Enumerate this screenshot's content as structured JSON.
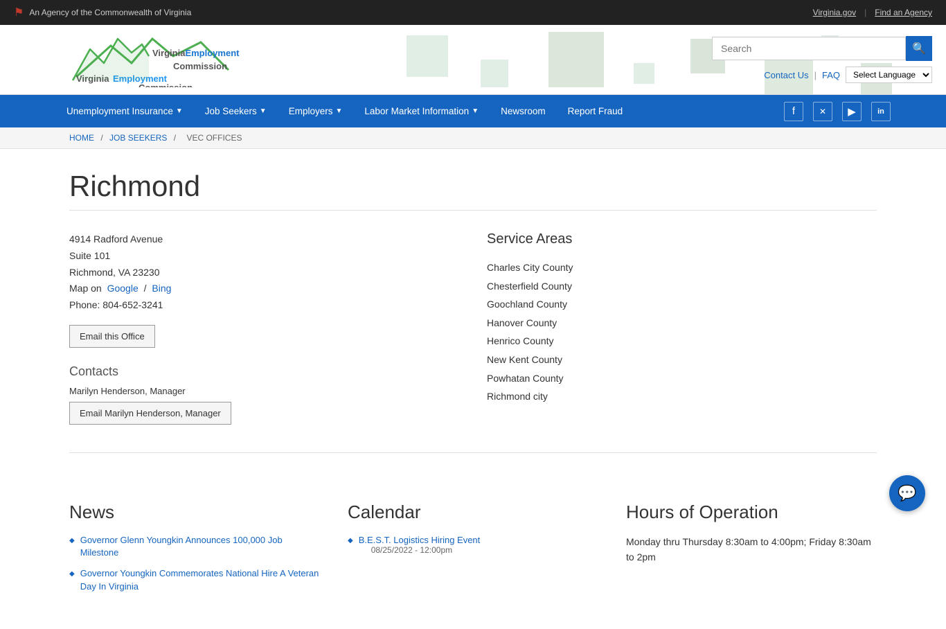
{
  "topbar": {
    "agency_text": "An Agency of the Commonwealth of Virginia",
    "virginia_link": "Virginia.gov",
    "find_agency_link": "Find an Agency"
  },
  "header": {
    "logo_line1": "Virginia",
    "logo_line2": "Employment",
    "logo_line3": "Commission",
    "search_placeholder": "Search",
    "contact_us": "Contact Us",
    "faq": "FAQ",
    "language_select": "Select Language"
  },
  "nav": {
    "items": [
      {
        "label": "Unemployment Insurance",
        "has_dropdown": true
      },
      {
        "label": "Job Seekers",
        "has_dropdown": true
      },
      {
        "label": "Employers",
        "has_dropdown": true
      },
      {
        "label": "Labor Market Information",
        "has_dropdown": true
      },
      {
        "label": "Newsroom",
        "has_dropdown": false
      },
      {
        "label": "Report Fraud",
        "has_dropdown": false
      }
    ],
    "social": [
      "f",
      "𝕏",
      "▶",
      "in"
    ]
  },
  "breadcrumb": {
    "items": [
      "HOME",
      "JOB SEEKERS",
      "VEC OFFICES"
    ]
  },
  "office": {
    "title": "Richmond",
    "address_line1": "4914 Radford Avenue",
    "address_line2": "Suite 101",
    "address_line3": "Richmond, VA 23230",
    "map_prefix": "Map on",
    "map_google": "Google",
    "map_separator": "/",
    "map_bing": "Bing",
    "phone": "Phone: 804-652-3241",
    "email_office_btn": "Email this Office",
    "contacts_title": "Contacts",
    "contact_name": "Marilyn Henderson, Manager",
    "contact_email_btn": "Email Marilyn Henderson, Manager"
  },
  "service_areas": {
    "title": "Service Areas",
    "areas": [
      "Charles City County",
      "Chesterfield County",
      "Goochland County",
      "Hanover County",
      "Henrico County",
      "New Kent County",
      "Powhatan County",
      "Richmond city"
    ]
  },
  "news": {
    "title": "News",
    "items": [
      {
        "text": "Governor Glenn Youngkin Announces 100,000 Job Milestone"
      },
      {
        "text": "Governor Youngkin Commemorates National Hire A Veteran Day In Virginia"
      }
    ]
  },
  "calendar": {
    "title": "Calendar",
    "items": [
      {
        "event": "B.E.S.T. Logistics Hiring Event",
        "date": "08/25/2022 - 12:00pm"
      }
    ]
  },
  "hours": {
    "title": "Hours of Operation",
    "text": "Monday thru Thursday 8:30am to 4:00pm; Friday 8:30am to 2pm"
  }
}
